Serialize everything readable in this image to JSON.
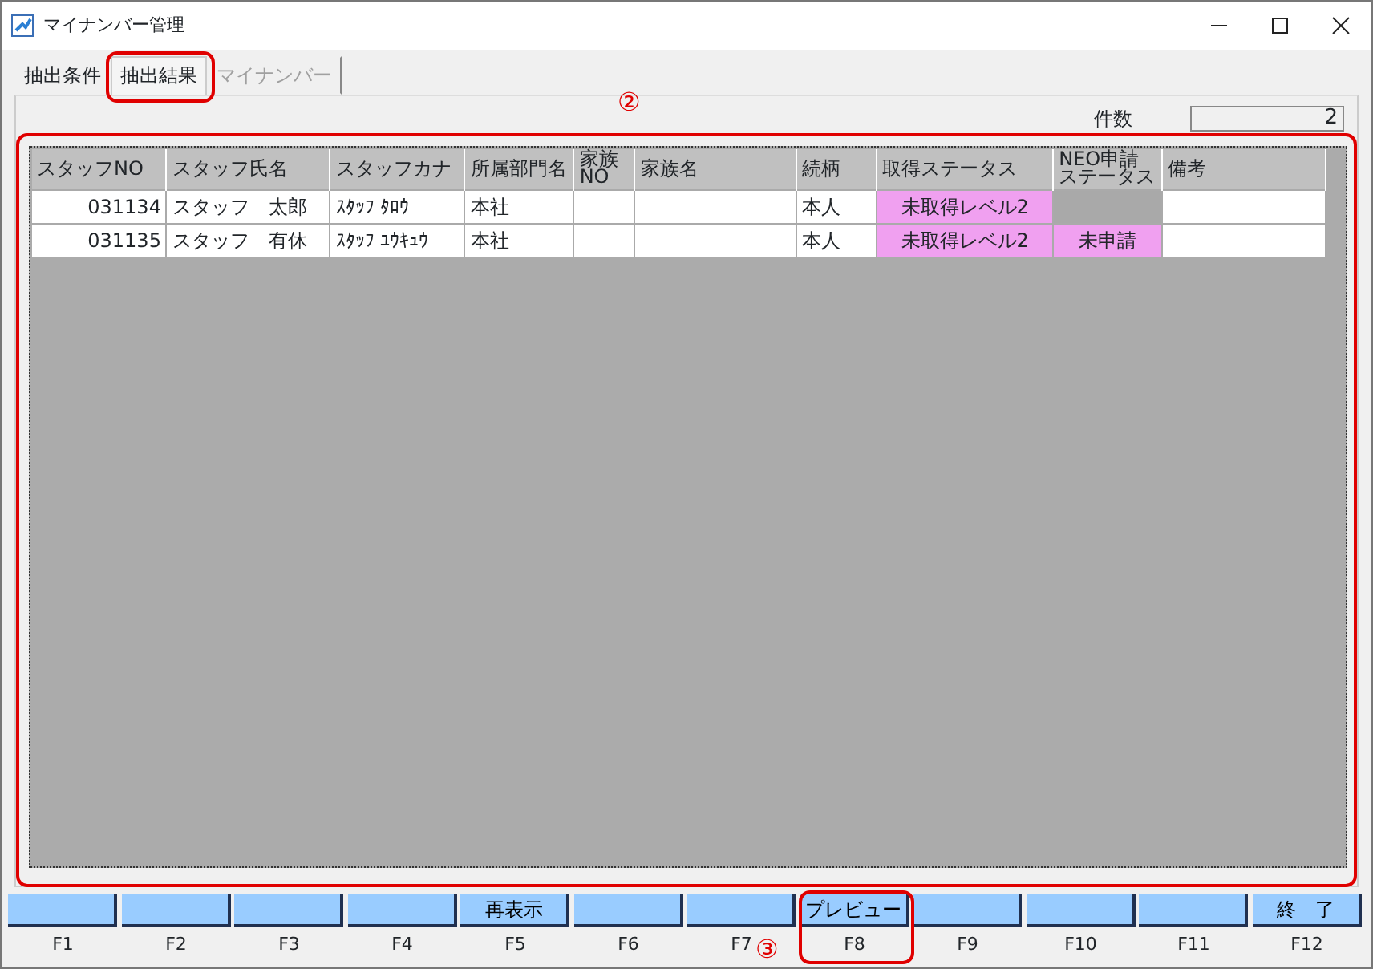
{
  "window": {
    "title": "マイナンバー管理"
  },
  "tabs": [
    {
      "label": "抽出条件",
      "selected": false,
      "disabled": false
    },
    {
      "label": "抽出結果",
      "selected": true,
      "disabled": false,
      "highlighted": true
    },
    {
      "label": "マイナンバー",
      "selected": false,
      "disabled": true
    }
  ],
  "count": {
    "label": "件数",
    "value": "2"
  },
  "table": {
    "highlighted": true,
    "columns": [
      "スタッフNO",
      "スタッフ氏名",
      "スタッフカナ",
      "所属部門名",
      "家族NO",
      "家族名",
      "続柄",
      "取得ステータス",
      "NEO申請ステータス",
      "備考"
    ],
    "rows": [
      {
        "cells": [
          {
            "text": "031134"
          },
          {
            "text": "スタッフ　太郎"
          },
          {
            "text": "ｽﾀｯﾌ ﾀﾛｳ"
          },
          {
            "text": "本社"
          },
          {},
          {},
          {
            "text": "本人"
          },
          {
            "text": "未取得レベル2",
            "color": "#f0a0f0"
          },
          {
            "color": "#a9a9a9"
          },
          {}
        ]
      },
      {
        "cells": [
          {
            "text": "031135"
          },
          {
            "text": "スタッフ　有休"
          },
          {
            "text": "ｽﾀｯﾌ ﾕｳｷｭｳ"
          },
          {
            "text": "本社"
          },
          {},
          {},
          {
            "text": "本人"
          },
          {
            "text": "未取得レベル2",
            "color": "#f0a0f0"
          },
          {
            "text": "未申請",
            "color": "#f0a0f0"
          },
          {}
        ]
      }
    ]
  },
  "function_keys": [
    {
      "key": "F1"
    },
    {
      "key": "F2"
    },
    {
      "key": "F3"
    },
    {
      "key": "F4"
    },
    {
      "label": "再表示",
      "key": "F5"
    },
    {
      "key": "F6"
    },
    {
      "key": "F7"
    },
    {
      "label": "プレビュー",
      "key": "F8",
      "highlighted": true
    },
    {
      "key": "F9"
    },
    {
      "key": "F10"
    },
    {
      "key": "F11"
    },
    {
      "label": "終　了",
      "key": "F12"
    }
  ],
  "annotations": [
    {
      "text": "②"
    },
    {
      "text": "③"
    }
  ]
}
